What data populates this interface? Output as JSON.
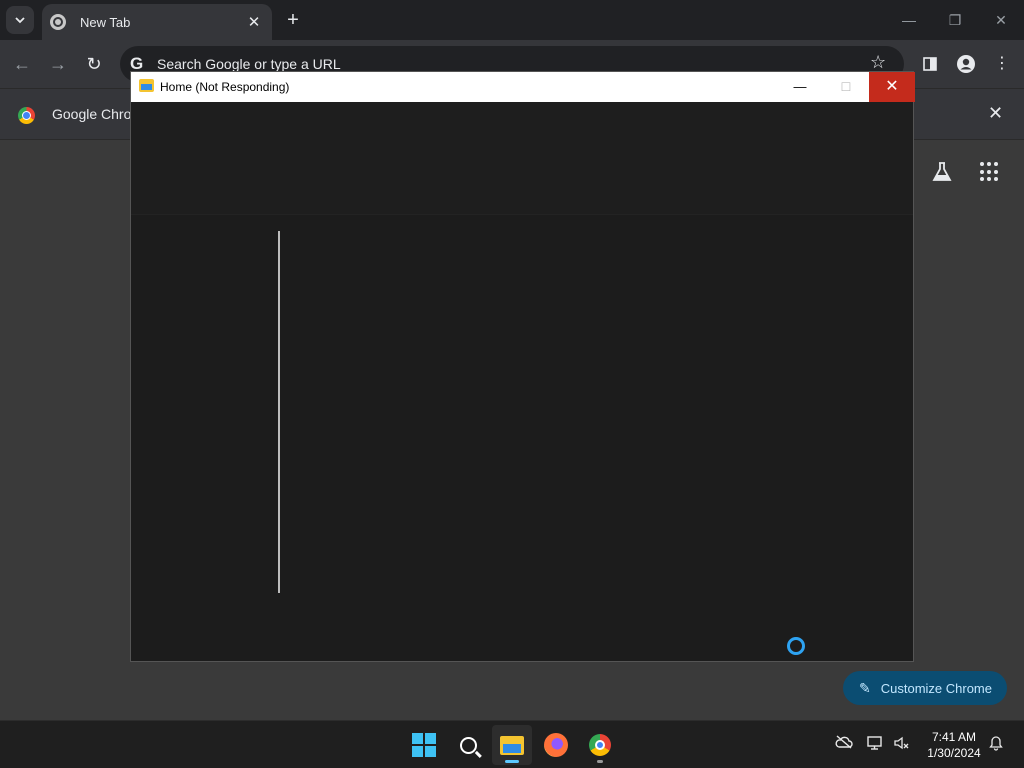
{
  "browser": {
    "tab": {
      "title": "New Tab",
      "close": "✕"
    },
    "new_tab": "+",
    "window_controls": {
      "minimize": "—",
      "restore": "❐",
      "close": "✕"
    },
    "toolbar": {
      "back": "←",
      "forward": "→",
      "reload": "↻",
      "g_logo": "G",
      "omnibox_placeholder": "Search Google or type a URL",
      "star": "☆",
      "menu": "⋮"
    },
    "infobar": {
      "text": "Google Chrome",
      "close": "✕"
    },
    "ntp": {
      "customize_label": "Customize Chrome"
    }
  },
  "explorer": {
    "title": "Home (Not Responding)",
    "minimize": "—",
    "maximize": "☐",
    "close": "✕"
  },
  "taskbar": {
    "apps": [
      "start",
      "search",
      "file-explorer",
      "firefox",
      "chrome"
    ],
    "clock": {
      "time": "7:41 AM",
      "date": "1/30/2024"
    }
  },
  "colors": {
    "explorer_close_bg": "#c42b1c",
    "customize_bg": "#0b4d72",
    "accent": "#2ea3f2"
  }
}
